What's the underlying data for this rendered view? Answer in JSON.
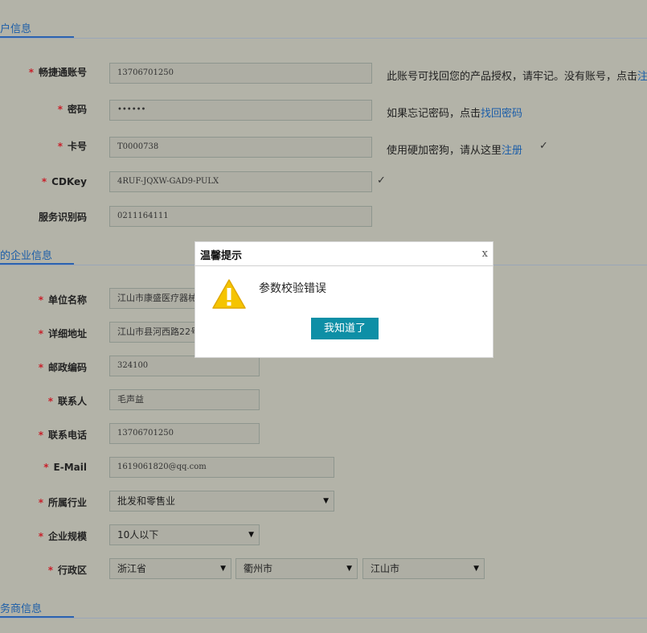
{
  "sections": {
    "account": "户信息",
    "company": "的企业信息",
    "business": "务商信息"
  },
  "account_form": {
    "account_label": "畅捷通账号",
    "account_value": "13706701250",
    "account_hint": "此账号可找回您的产品授权，请牢记。没有账号，点击",
    "account_hint_link": "注",
    "password_label": "密码",
    "password_value": "••••••",
    "password_hint": "如果忘记密码，点击",
    "password_hint_link": "找回密码",
    "card_label": "卡号",
    "card_value": "T0000738",
    "card_hint": "使用硬加密狗，请从这里",
    "card_hint_link": "注册",
    "cdkey_label": "CDKey",
    "cdkey_value": "4RUF-JQXW-GAD9-PULX",
    "service_label": "服务识别码",
    "service_value": "0211164111",
    "check_mark": "✓"
  },
  "company_form": {
    "name_label": "单位名称",
    "name_value": "江山市康盛医疗器械",
    "address_label": "详细地址",
    "address_value": "江山市县河西路22号",
    "zip_label": "邮政编码",
    "zip_value": "324100",
    "contact_label": "联系人",
    "contact_value": "毛声益",
    "phone_label": "联系电话",
    "phone_value": "13706701250",
    "email_label": "E-Mail",
    "email_value": "1619061820@qq.com",
    "industry_label": "所属行业",
    "industry_value": "批发和零售业",
    "scale_label": "企业规模",
    "scale_value": "10人以下",
    "region_label": "行政区",
    "province_value": "浙江省",
    "city_value": "衢州市",
    "county_value": "江山市"
  },
  "required_mark": "*",
  "modal": {
    "title": "温馨提示",
    "close": "x",
    "message": "参数校验错误",
    "button": "我知道了",
    "icon": "warning-icon",
    "icon_color": "#f5c400"
  },
  "colors": {
    "overlay_bg": "#b3b3a8",
    "link": "#1c5ea8",
    "required": "#c8202a",
    "button": "#0e8fa6"
  }
}
